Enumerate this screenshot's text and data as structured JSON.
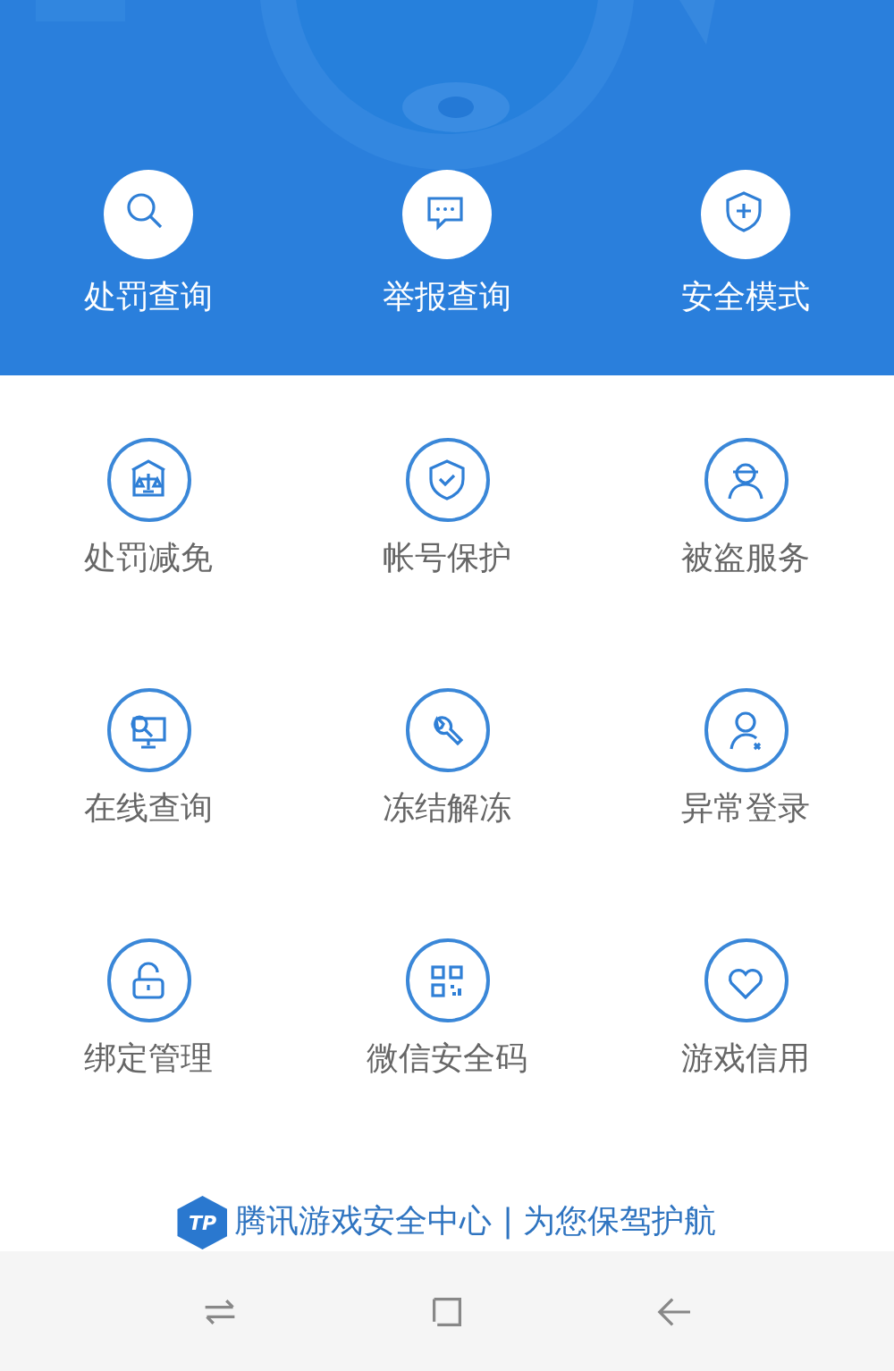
{
  "header": {
    "actions": [
      {
        "label": "处罚查询"
      },
      {
        "label": "举报查询"
      },
      {
        "label": "安全模式"
      }
    ]
  },
  "services": [
    {
      "label": "处罚减免"
    },
    {
      "label": "帐号保护"
    },
    {
      "label": "被盗服务"
    },
    {
      "label": "在线查询"
    },
    {
      "label": "冻结解冻"
    },
    {
      "label": "异常登录"
    },
    {
      "label": "绑定管理"
    },
    {
      "label": "微信安全码"
    },
    {
      "label": "游戏信用"
    }
  ],
  "footer": {
    "logo_text": "TP",
    "slogan": "腾讯游戏安全中心 | 为您保驾护航"
  }
}
